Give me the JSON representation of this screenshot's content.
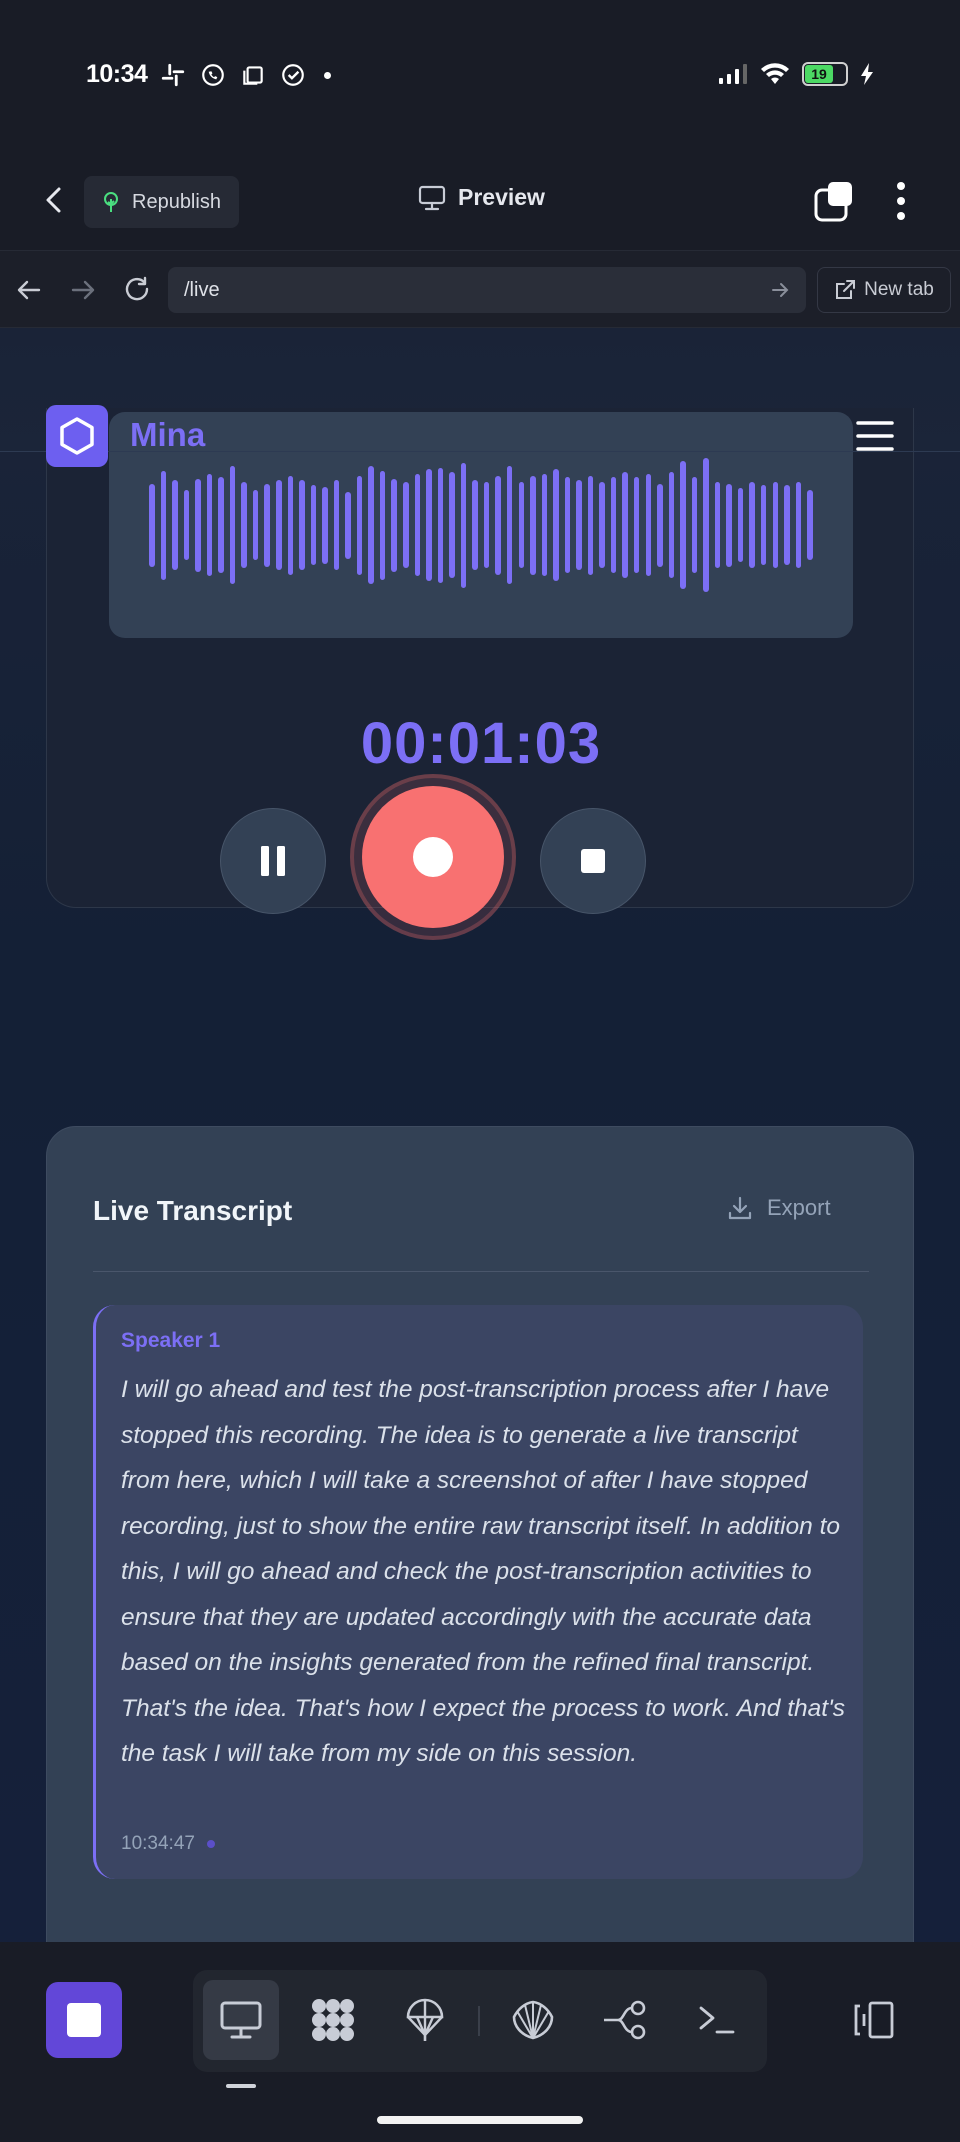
{
  "status_bar": {
    "time": "10:34",
    "battery_level": "19"
  },
  "app_bar": {
    "republish_label": "Republish",
    "title": "Preview"
  },
  "browser": {
    "url": "/live",
    "new_tab_label": "New tab"
  },
  "site": {
    "brand": "Mina"
  },
  "recorder": {
    "timer": "00:01:03",
    "waveform_levels": [
      0.52,
      0.68,
      0.56,
      0.44,
      0.58,
      0.64,
      0.6,
      0.74,
      0.54,
      0.44,
      0.52,
      0.56,
      0.62,
      0.56,
      0.5,
      0.48,
      0.56,
      0.42,
      0.62,
      0.74,
      0.68,
      0.58,
      0.54,
      0.64,
      0.7,
      0.72,
      0.66,
      0.78,
      0.56,
      0.54,
      0.62,
      0.74,
      0.54,
      0.62,
      0.64,
      0.7,
      0.6,
      0.56,
      0.62,
      0.54,
      0.6,
      0.66,
      0.6,
      0.64,
      0.52,
      0.66,
      0.8,
      0.6,
      0.84,
      0.54,
      0.52,
      0.46,
      0.54,
      0.5,
      0.54,
      0.5,
      0.54,
      0.44
    ],
    "accent_color": "#7c6ff5",
    "record_color": "#f87171"
  },
  "transcript": {
    "title": "Live Transcript",
    "export_label": "Export",
    "entries": [
      {
        "speaker": "Speaker 1",
        "text": "I will go ahead and test the post-transcription process after I have stopped this recording. The idea is to generate a live transcript from here, which I will take a screenshot of after I have stopped recording, just to show the entire raw transcript itself. In addition to this, I will go ahead and check the post-transcription activities to ensure that they are updated accordingly with the accurate data based on the insights generated from the refined final transcript. That's the idea. That's how I expect the process to work. And that's the task I will take from my side on this session.",
        "time": "10:34:47"
      }
    ]
  },
  "dock": {
    "items": [
      "monitor-icon",
      "apps-grid-icon",
      "parachute-icon",
      "shell-icon",
      "branch-icon",
      "terminal-icon"
    ],
    "active": "monitor-icon"
  }
}
